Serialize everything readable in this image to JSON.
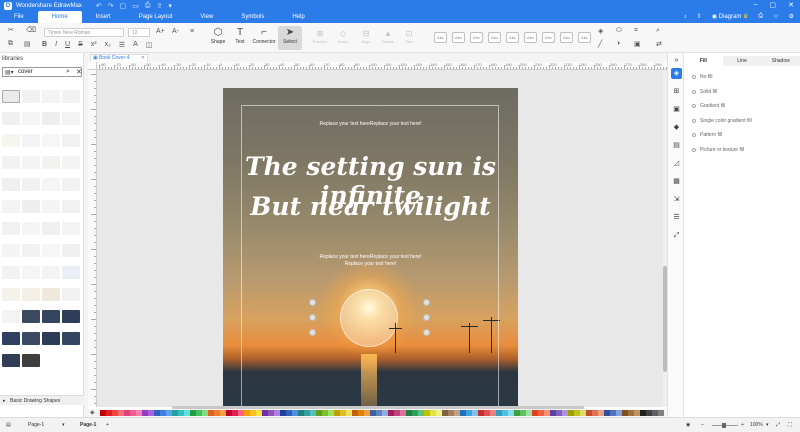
{
  "app": {
    "title": "Wondershare EdrawMax"
  },
  "menu": {
    "items": [
      "File",
      "Home",
      "Insert",
      "Page Layout",
      "View",
      "Symbols",
      "Help"
    ],
    "active": "Home"
  },
  "header_right": {
    "diagram_label": "Diagram"
  },
  "ribbon": {
    "font_name": "Times New Roman",
    "font_size": "12",
    "format": {
      "bold": "B",
      "italic": "I",
      "underline": "U",
      "strike": "S"
    },
    "tools": {
      "shape": "Shape",
      "text": "Text",
      "connector": "Connector",
      "select": "Select"
    },
    "grey_tools": {
      "position": "Position",
      "group": "Group",
      "align": "Align",
      "rotate": "Rotate",
      "size": "Size"
    },
    "style_labels": [
      "Abc",
      "Abc",
      "Abc",
      "Abc",
      "Abc",
      "Abc",
      "Abc",
      "Abc",
      "Abc"
    ]
  },
  "libraries": {
    "title": "libraries",
    "search_value": "cover",
    "section": "Basic Drawing Shapes"
  },
  "document": {
    "tab_name": "Book Cover 4"
  },
  "ruler": {
    "labels": [
      "-80",
      "-70",
      "-60",
      "-50",
      "-40",
      "-30",
      "-20",
      "-10",
      "0",
      "10",
      "20",
      "30",
      "40",
      "50",
      "60",
      "70",
      "80",
      "90",
      "100",
      "110",
      "120",
      "130",
      "140",
      "150",
      "160",
      "170",
      "180",
      "190",
      "200",
      "210",
      "220",
      "230",
      "240",
      "250",
      "260",
      "270",
      "280",
      "290"
    ]
  },
  "page": {
    "top_text": "Replace your text hereReplace your text here!",
    "headline_1": "The setting sun is infinite",
    "headline_2": "But near twilight",
    "sub_text_1": "Replace your text hereReplace your text here!",
    "sub_text_2": "Replace your text here!"
  },
  "right_panel": {
    "tabs": [
      "Fill",
      "Line",
      "Shadow"
    ],
    "active_tab": "Fill",
    "fill_options": [
      "No fill",
      "Solid fill",
      "Gradient fill",
      "Single color gradient fill",
      "Pattern fill",
      "Picture or texture fill"
    ]
  },
  "palette_colors": [
    "#c00000",
    "#e02020",
    "#ff4040",
    "#ff7070",
    "#e04080",
    "#f06090",
    "#ff80b0",
    "#9040c0",
    "#b060e0",
    "#3060c0",
    "#4080e0",
    "#60a0f0",
    "#20a0a0",
    "#30c0c0",
    "#60e0e0",
    "#20a040",
    "#40c060",
    "#80e080",
    "#e06020",
    "#f08030",
    "#ffa040",
    "#c00030",
    "#e02050",
    "#ff6080",
    "#f0a000",
    "#ffc020",
    "#ffe040",
    "#7030a0",
    "#9050c0",
    "#b080e0",
    "#2040a0",
    "#3060c0",
    "#5090e0",
    "#208080",
    "#30a0a0",
    "#50c0c0",
    "#60a020",
    "#80c030",
    "#a0e060",
    "#c0a000",
    "#e0c020",
    "#f0e060",
    "#c06000",
    "#e08000",
    "#f0a040",
    "#4060a0",
    "#6080c0",
    "#90b0e0",
    "#a02060",
    "#c04080",
    "#e070a0",
    "#208040",
    "#30a060",
    "#60c080",
    "#c0c000",
    "#e0e040",
    "#f0f080",
    "#806040",
    "#a08060",
    "#c0a080",
    "#2070c0",
    "#40a0e0",
    "#80c0f0",
    "#c03030",
    "#e05050",
    "#f08080",
    "#30a0c0",
    "#50c0e0",
    "#80e0f0",
    "#40a040",
    "#60c060",
    "#a0e0a0",
    "#e04020",
    "#f06040",
    "#ff9070",
    "#6040a0",
    "#8060c0",
    "#b090e0",
    "#a0a000",
    "#c0c020",
    "#e0e060",
    "#c05030",
    "#e07050",
    "#f0a080",
    "#3050a0",
    "#5070c0",
    "#80a0e0",
    "#805020",
    "#a07040",
    "#c09060",
    "#202020",
    "#404040",
    "#606060",
    "#808080",
    "#a0a0a0",
    "#c0c0c0",
    "#e0e0e0",
    "#f0f0f0"
  ],
  "status": {
    "page_selector": "Page-1",
    "page_tab": "Page-1",
    "zoom": "100%"
  }
}
